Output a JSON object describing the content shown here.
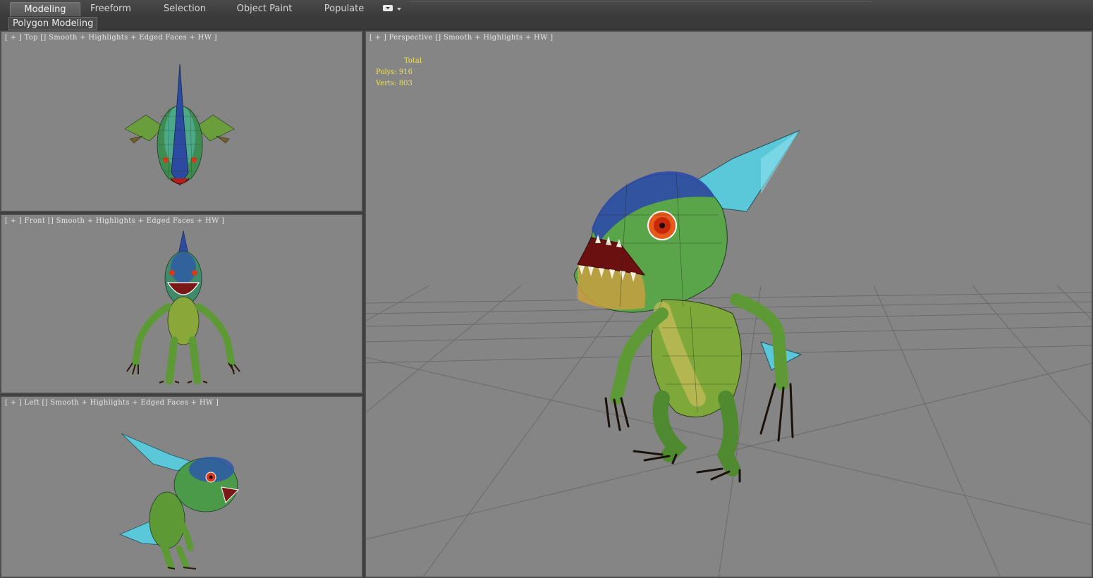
{
  "ribbon": {
    "tabs": [
      {
        "label": "Modeling",
        "active": true
      },
      {
        "label": "Freeform",
        "active": false
      },
      {
        "label": "Selection",
        "active": false
      },
      {
        "label": "Object Paint",
        "active": false
      },
      {
        "label": "Populate",
        "active": false
      }
    ],
    "panel_label": "Polygon Modeling"
  },
  "viewports": {
    "top": {
      "label": "[ + ] Top [] Smooth + Highlights + Edged Faces + HW ]"
    },
    "front": {
      "label": "[ + ] Front [] Smooth + Highlights + Edged Faces + HW ]"
    },
    "left": {
      "label": "[ + ] Left [] Smooth + Highlights + Edged Faces + HW ]"
    },
    "perspective": {
      "label": "[ + ] Perspective [] Smooth + Highlights + HW ]",
      "stats": {
        "header": "Total",
        "polys_label": "Polys:",
        "polys_value": "916",
        "verts_label": "Verts:",
        "verts_value": "803"
      }
    }
  },
  "colors": {
    "viewport_bg": "#858585",
    "stats_text": "#f0e24a",
    "ui_dark": "#3c3c3c"
  }
}
